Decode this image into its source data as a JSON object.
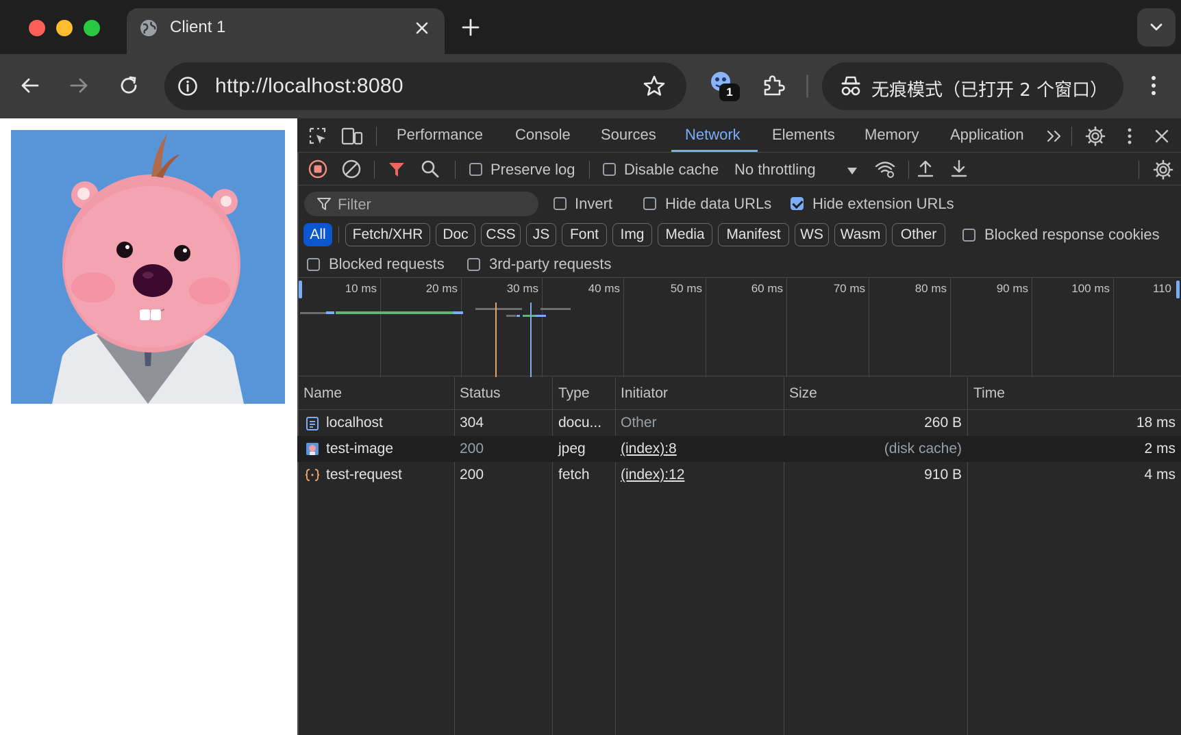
{
  "browser": {
    "tab_title": "Client 1",
    "url": "http://localhost:8080",
    "extension_badge_count": "1",
    "incognito_label": "无痕模式（已打开 2 个窗口）"
  },
  "devtools": {
    "tabs": [
      {
        "label": "Performance"
      },
      {
        "label": "Console"
      },
      {
        "label": "Sources"
      },
      {
        "label": "Network",
        "active": true
      },
      {
        "label": "Elements"
      },
      {
        "label": "Memory"
      },
      {
        "label": "Application"
      }
    ],
    "toolbar": {
      "preserve_log": {
        "label": "Preserve log",
        "checked": false
      },
      "disable_cache": {
        "label": "Disable cache",
        "checked": false
      },
      "throttling": "No throttling"
    },
    "filter": {
      "placeholder": "Filter",
      "invert": {
        "label": "Invert",
        "checked": false
      },
      "hide_data_urls": {
        "label": "Hide data URLs",
        "checked": false
      },
      "hide_extension_urls": {
        "label": "Hide extension URLs",
        "checked": true
      },
      "type_chips": [
        "All",
        "Fetch/XHR",
        "Doc",
        "CSS",
        "JS",
        "Font",
        "Img",
        "Media",
        "Manifest",
        "WS",
        "Wasm",
        "Other"
      ],
      "active_chip": "All",
      "blocked_response_cookies": {
        "label": "Blocked response cookies",
        "checked": false
      },
      "blocked_requests": {
        "label": "Blocked requests",
        "checked": false
      },
      "third_party_requests": {
        "label": "3rd-party requests",
        "checked": false
      }
    },
    "timeline": {
      "tick_labels": [
        "10 ms",
        "20 ms",
        "30 ms",
        "40 ms",
        "50 ms",
        "60 ms",
        "70 ms",
        "80 ms",
        "90 ms",
        "100 ms",
        "110"
      ]
    },
    "table": {
      "columns": [
        "Name",
        "Status",
        "Type",
        "Initiator",
        "Size",
        "Time"
      ],
      "rows": [
        {
          "icon": "document-icon",
          "name": "localhost",
          "status": "304",
          "type": "docu...",
          "initiator": "Other",
          "size": "260 B",
          "time": "18 ms"
        },
        {
          "icon": "image-icon",
          "name": "test-image",
          "status": "200",
          "type": "jpeg",
          "initiator": "(index):8",
          "size": "(disk cache)",
          "time": "2 ms"
        },
        {
          "icon": "fetch-icon",
          "name": "test-request",
          "status": "200",
          "type": "fetch",
          "initiator": "(index):12",
          "size": "910 B",
          "time": "4 ms"
        }
      ]
    }
  },
  "colors": {
    "accent": "#7cacf8",
    "chip_active": "#0b57d0",
    "record_red": "#f28b82",
    "filter_red": "#ee675c"
  }
}
